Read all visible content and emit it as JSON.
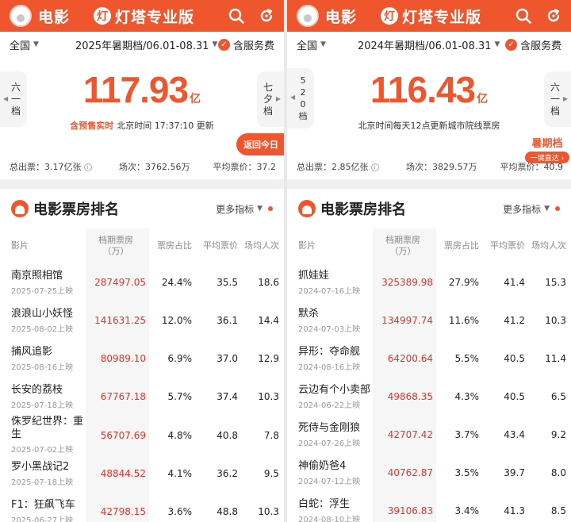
{
  "left": {
    "app_name": "电影",
    "brand_logo": "灯",
    "brand_name": "灯塔专业版",
    "region": "全国",
    "period": "2025年暑期档/06.01-08.31",
    "fee_label": "含服务费",
    "prev_tab": [
      "六",
      "一",
      "档"
    ],
    "next_tab": [
      "七",
      "夕",
      "档"
    ],
    "box_value": "117.93",
    "box_unit": "亿",
    "update_accent": "含预售实时",
    "update_text": "北京时间 17:37:10 更新",
    "cta_label": "返回今日",
    "stats": {
      "admissions": "总出票：3.17亿张",
      "shows": "场次：3762.56万",
      "avg_price": "平均票价：37.2"
    },
    "rank_title": "电影票房排名",
    "rank_more": "更多指标",
    "headers": {
      "film": "影片",
      "gross": "档期票房\n（万）",
      "share": "票房占比",
      "price": "平均票价",
      "aud": "场均人次"
    },
    "rows": [
      {
        "name": "南京照相馆",
        "date": "2025-07-25上映",
        "gross": "287497.05",
        "share": "24.4%",
        "price": "35.5",
        "aud": "18.6"
      },
      {
        "name": "浪浪山小妖怪",
        "date": "2025-08-02上映",
        "gross": "141631.25",
        "share": "12.0%",
        "price": "36.1",
        "aud": "14.4"
      },
      {
        "name": "捕风追影",
        "date": "2025-08-16上映",
        "gross": "80989.10",
        "share": "6.9%",
        "price": "37.0",
        "aud": "12.9"
      },
      {
        "name": "长安的荔枝",
        "date": "2025-07-18上映",
        "gross": "67767.18",
        "share": "5.7%",
        "price": "37.4",
        "aud": "10.3"
      },
      {
        "name": "侏罗纪世界：重生",
        "date": "2025-07-02上映",
        "gross": "56707.69",
        "share": "4.8%",
        "price": "40.8",
        "aud": "7.8"
      },
      {
        "name": "罗小黑战记2",
        "date": "2025-07-18上映",
        "gross": "48844.52",
        "share": "4.1%",
        "price": "36.2",
        "aud": "9.5"
      },
      {
        "name": "F1：狂飙飞车",
        "date": "2025-06-27上映",
        "gross": "42798.15",
        "share": "3.6%",
        "price": "48.8",
        "aud": "10.3"
      }
    ]
  },
  "right": {
    "app_name": "电影",
    "brand_logo": "灯",
    "brand_name": "灯塔专业版",
    "region": "全国",
    "period": "2024年暑期档/06.01-08.31",
    "fee_label": "含服务费",
    "prev_tab": [
      "5",
      "2",
      "0",
      "档"
    ],
    "next_tab": [
      "六",
      "一",
      "档"
    ],
    "box_value": "116.43",
    "box_unit": "亿",
    "update_text": "北京时间每天12点更新城市院线票房",
    "promo_title": "暑期档",
    "promo_sub": "一键直达 ›",
    "stats": {
      "admissions": "总出票：2.85亿张",
      "shows": "场次：3829.57万",
      "avg_price": "平均票价：40.9"
    },
    "rank_title": "电影票房排名",
    "rank_more": "更多指标",
    "headers": {
      "film": "影片",
      "gross": "档期票房\n（万）",
      "share": "票房占比",
      "price": "平均票价",
      "aud": "场均人次"
    },
    "rows": [
      {
        "name": "抓娃娃",
        "date": "2024-07-16上映",
        "gross": "325389.98",
        "share": "27.9%",
        "price": "41.4",
        "aud": "15.3"
      },
      {
        "name": "默杀",
        "date": "2024-07-03上映",
        "gross": "134997.74",
        "share": "11.6%",
        "price": "41.2",
        "aud": "10.3"
      },
      {
        "name": "异形：夺命舰",
        "date": "2024-08-16上映",
        "gross": "64200.64",
        "share": "5.5%",
        "price": "40.5",
        "aud": "11.4"
      },
      {
        "name": "云边有个小卖部",
        "date": "2024-06-22上映",
        "gross": "49868.35",
        "share": "4.3%",
        "price": "40.5",
        "aud": "6.5"
      },
      {
        "name": "死侍与金刚狼",
        "date": "2024-07-26上映",
        "gross": "42707.42",
        "share": "3.7%",
        "price": "43.4",
        "aud": "9.2"
      },
      {
        "name": "神偷奶爸4",
        "date": "2024-07-12上映",
        "gross": "40762.87",
        "share": "3.5%",
        "price": "39.7",
        "aud": "8.0"
      },
      {
        "name": "白蛇：浮生",
        "date": "2024-08-10上映",
        "gross": "39106.83",
        "share": "3.4%",
        "price": "41.3",
        "aud": "8.5"
      }
    ]
  },
  "icons": {
    "avatar": "avatar",
    "search": "search-icon",
    "refresh": "refresh-icon",
    "check": "check-circle-icon",
    "info": "info-icon"
  },
  "colors": {
    "accent": "#f0562e",
    "gross_text": "#e4322b"
  }
}
